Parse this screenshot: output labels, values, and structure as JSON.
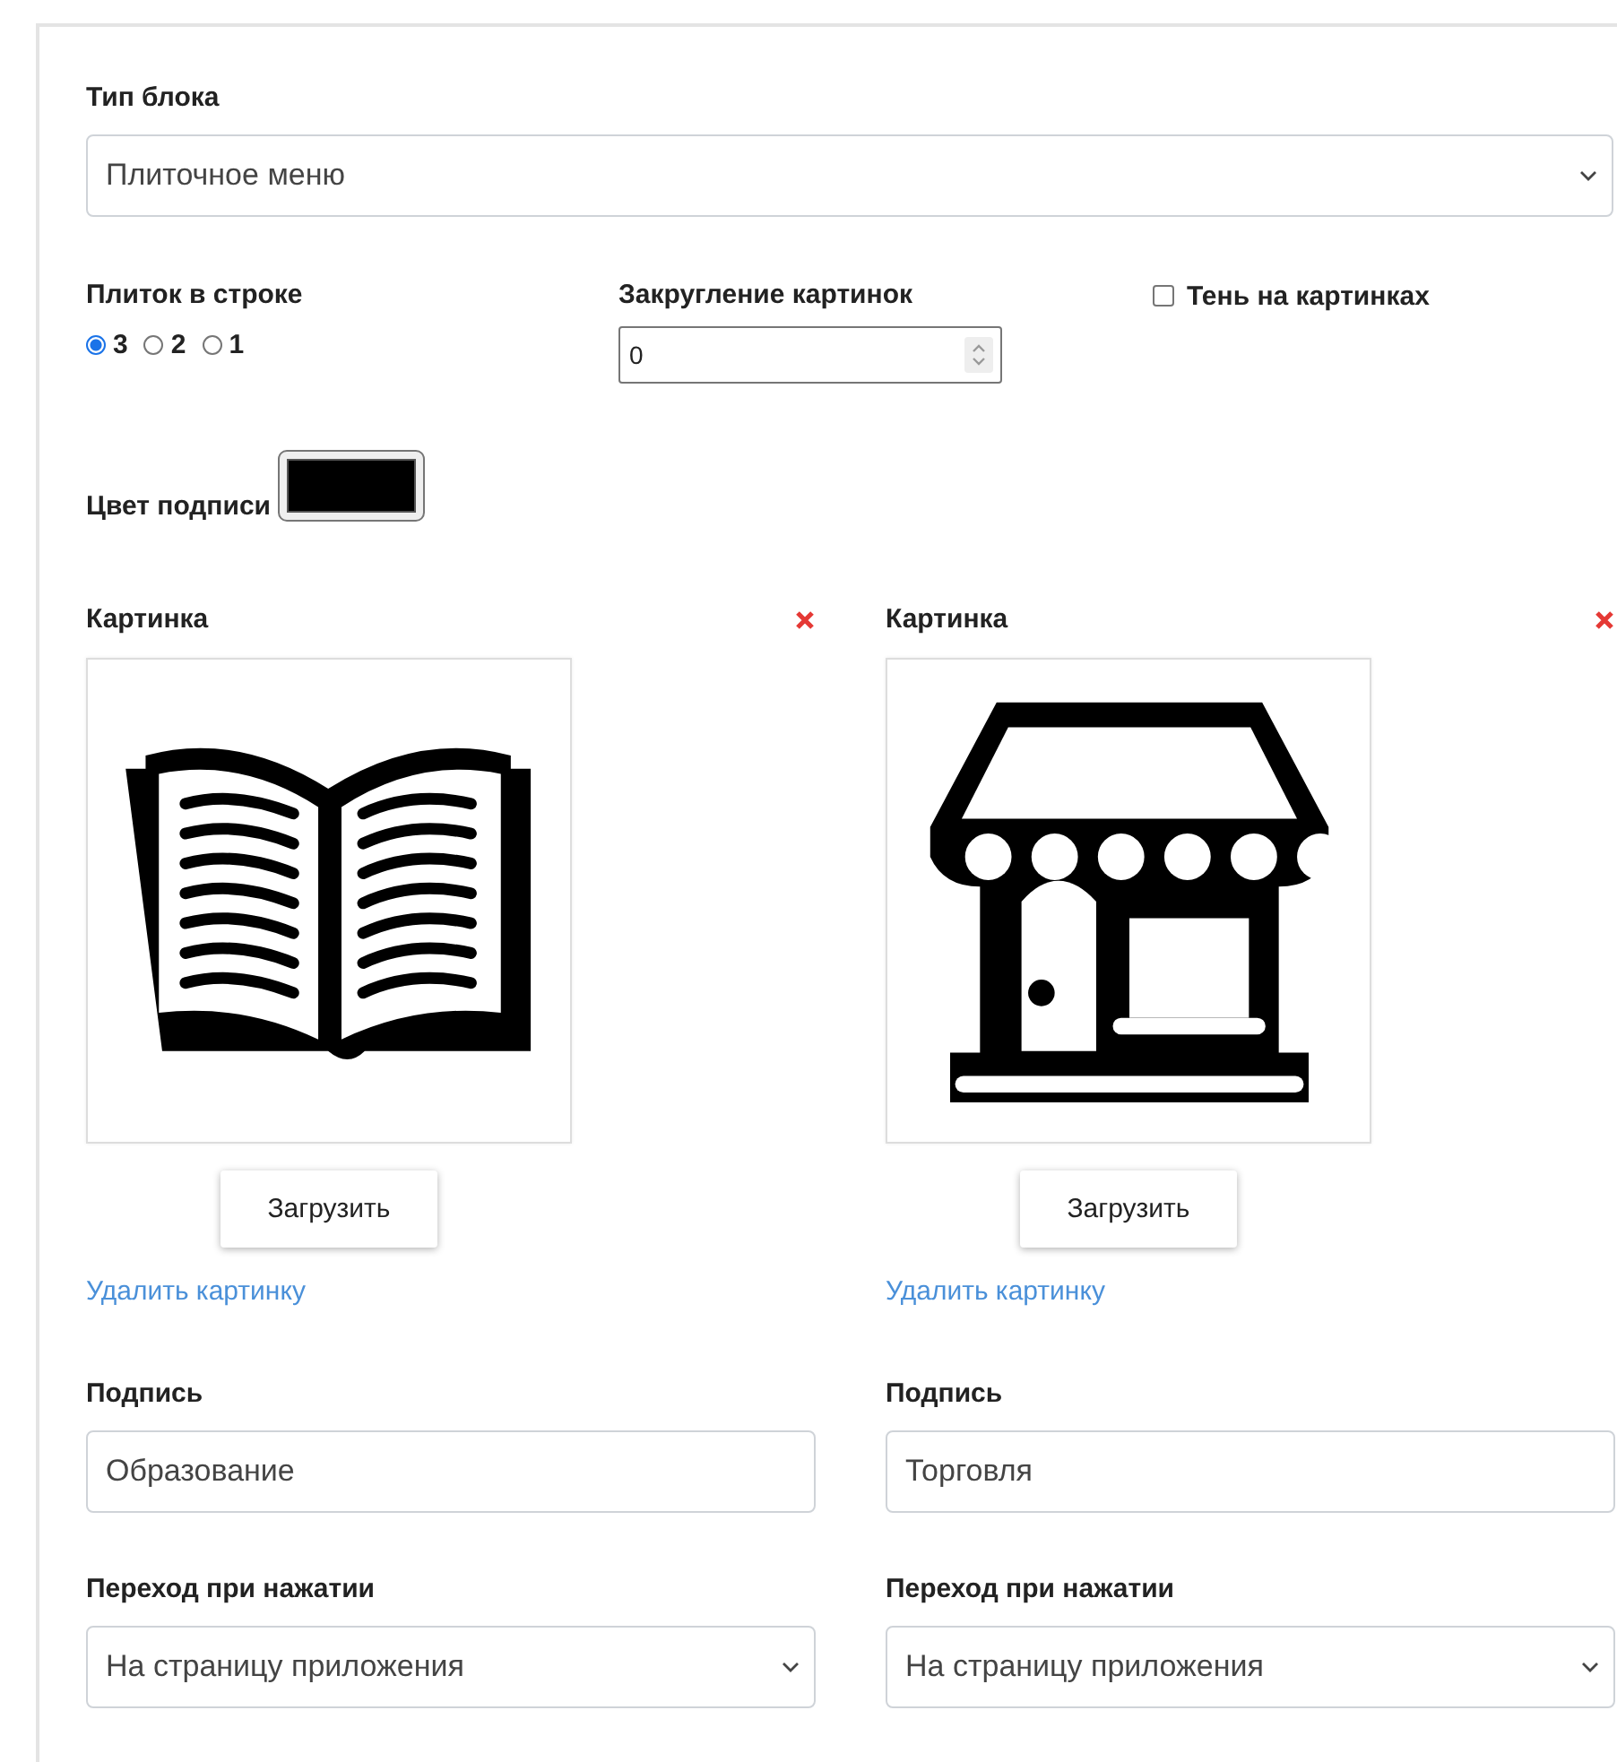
{
  "block_type": {
    "label": "Тип блока",
    "value": "Плиточное меню"
  },
  "tiles_per_row": {
    "label": "Плиток в строке",
    "options": [
      {
        "label": "3",
        "selected": true
      },
      {
        "label": "2",
        "selected": false
      },
      {
        "label": "1",
        "selected": false
      }
    ]
  },
  "image_rounding": {
    "label": "Закругление картинок",
    "value": "0"
  },
  "image_shadow": {
    "label": "Тень на картинках",
    "checked": false
  },
  "caption_color": {
    "label": "Цвет подписи",
    "color": "#000000"
  },
  "tiles": [
    {
      "image_label": "Картинка",
      "image": {
        "kind": "book"
      },
      "upload_button": "Загрузить",
      "delete_link": "Удалить картинку",
      "caption_label": "Подпись",
      "caption": "Образование",
      "action_label": "Переход при нажатии",
      "action": "На страницу приложения"
    },
    {
      "image_label": "Картинка",
      "image": {
        "kind": "shop"
      },
      "upload_button": "Загрузить",
      "delete_link": "Удалить картинку",
      "caption_label": "Подпись",
      "caption": "Торговля",
      "action_label": "Переход при нажатии",
      "action": "На страницу приложения"
    }
  ]
}
